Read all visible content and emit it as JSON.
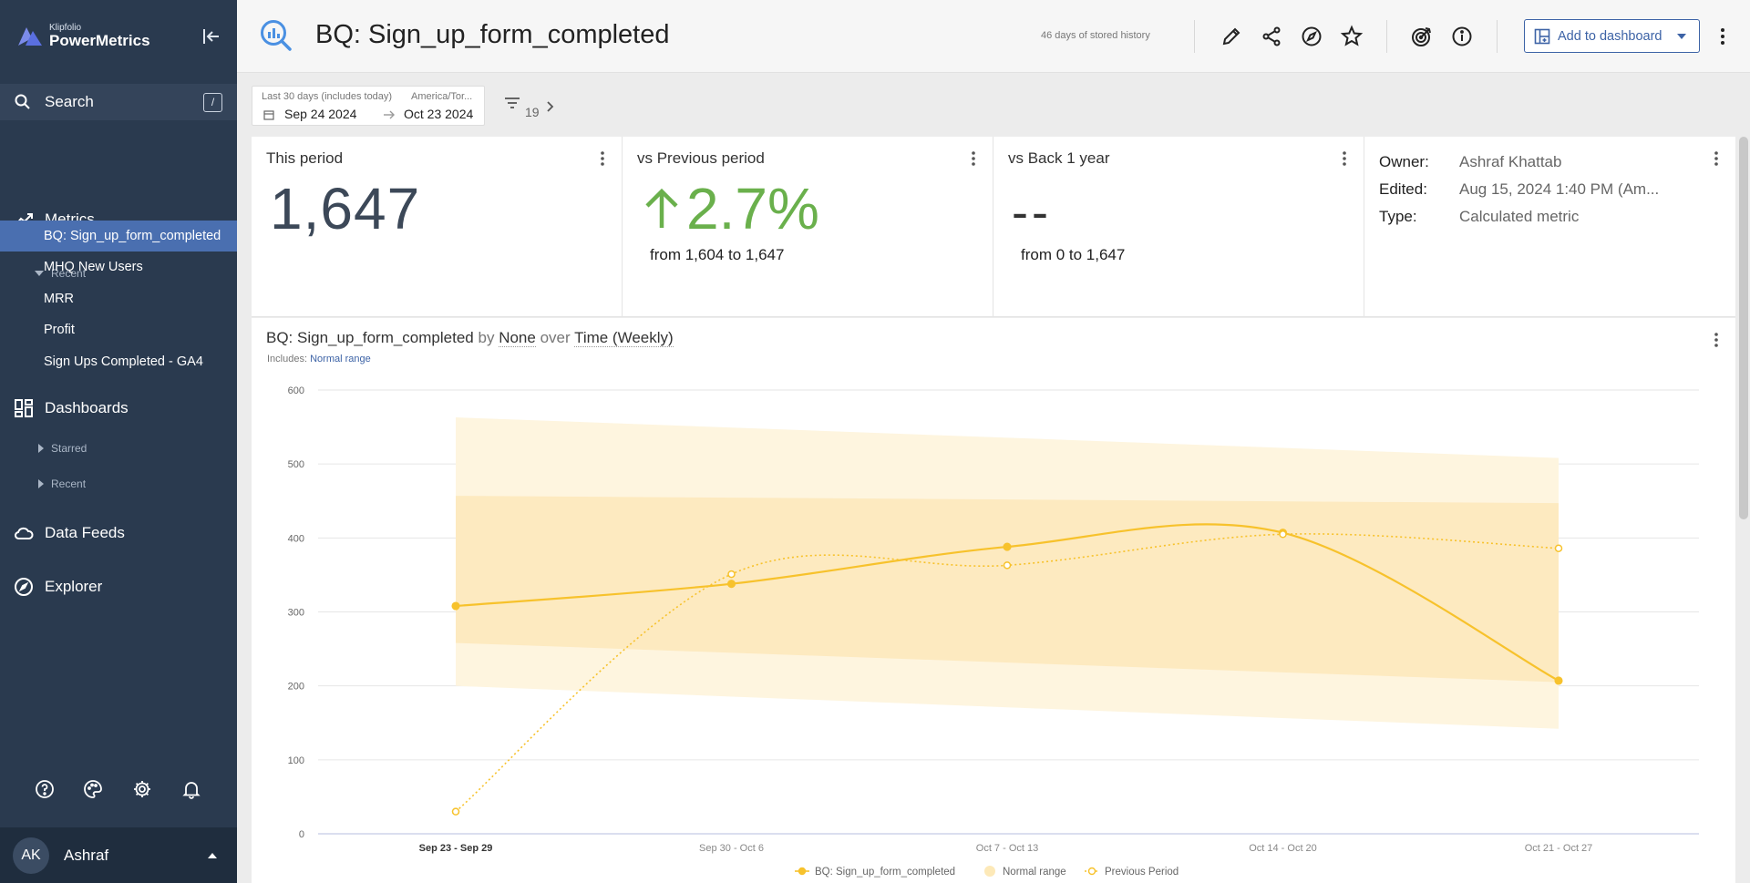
{
  "brand": {
    "small": "Klipfolio",
    "big": "PowerMetrics"
  },
  "sidebar": {
    "search_label": "Search",
    "search_shortcut": "/",
    "metrics_label": "Metrics",
    "recent_label": "Recent",
    "recent_metrics": [
      "BQ: Sign_up_form_completed",
      "MHQ New Users",
      "MRR",
      "Profit",
      "Sign Ups Completed - GA4"
    ],
    "active_index": 0,
    "dashboards_label": "Dashboards",
    "starred_label": "Starred",
    "dash_recent_label": "Recent",
    "datafeeds_label": "Data Feeds",
    "explorer_label": "Explorer",
    "footer_icons": [
      "help-icon",
      "palette-icon",
      "settings-icon",
      "bell-icon"
    ],
    "user_initials": "AK",
    "user_name": "Ashraf"
  },
  "header": {
    "title": "BQ: Sign_up_form_completed",
    "history": "46 days of stored history",
    "add_to_dashboard": "Add to dashboard",
    "icons": [
      "pencil-icon",
      "share-icon",
      "explore-icon",
      "star-icon",
      "goal-icon",
      "info-icon"
    ]
  },
  "filters": {
    "range_label": "Last 30 days (includes today)",
    "timezone": "America/Tor...",
    "start": "Sep 24 2024",
    "end": "Oct 23 2024",
    "filter_count": "19"
  },
  "cards": {
    "this_period": {
      "title": "This period",
      "value": "1,647"
    },
    "vs_previous": {
      "title": "vs Previous period",
      "value": "2.7%",
      "direction": "up",
      "detail": "from 1,604 to 1,647"
    },
    "vs_year": {
      "title": "vs Back 1 year",
      "value": "--",
      "detail": "from 0 to 1,647"
    },
    "meta": {
      "owner_key": "Owner:",
      "owner": "Ashraf Khattab",
      "edited_key": "Edited:",
      "edited": "Aug 15, 2024 1:40 PM (Am...",
      "type_key": "Type:",
      "type": "Calculated metric"
    }
  },
  "chart": {
    "title_metric": "BQ: Sign_up_form_completed",
    "by_word": "by",
    "dimension": "None",
    "over_word": "over",
    "time": "Time (Weekly)",
    "includes_label": "Includes:",
    "includes_link": "Normal range"
  },
  "chart_data": {
    "type": "line",
    "categories": [
      "Sep 23 - Sep 29",
      "Sep 30 - Oct 6",
      "Oct 7 - Oct 13",
      "Oct 14 - Oct 20",
      "Oct 21 - Oct 27"
    ],
    "ylim": [
      0,
      600
    ],
    "yticks": [
      0,
      100,
      200,
      300,
      400,
      500,
      600
    ],
    "grid": true,
    "legend_position": "bottom",
    "series": [
      {
        "name": "BQ: Sign_up_form_completed",
        "values": [
          308,
          338,
          388,
          407,
          207
        ],
        "color": "#f7c22c",
        "style": "solid"
      },
      {
        "name": "Previous Period",
        "values": [
          30,
          351,
          363,
          405,
          386
        ],
        "color": "#f7c22c",
        "style": "dotted"
      }
    ],
    "normal_range": {
      "name": "Normal range",
      "outer_upper": [
        563,
        508
      ],
      "outer_lower": [
        200,
        142
      ],
      "inner_upper": [
        457,
        447
      ],
      "inner_lower": [
        258,
        205
      ],
      "color": "#fde9b8"
    }
  },
  "colors": {
    "sidebar": "#2a3a4f",
    "active": "#4a6fb0",
    "accent": "#3d63a6",
    "positive": "#6ab04c",
    "series": "#f7c22c"
  }
}
